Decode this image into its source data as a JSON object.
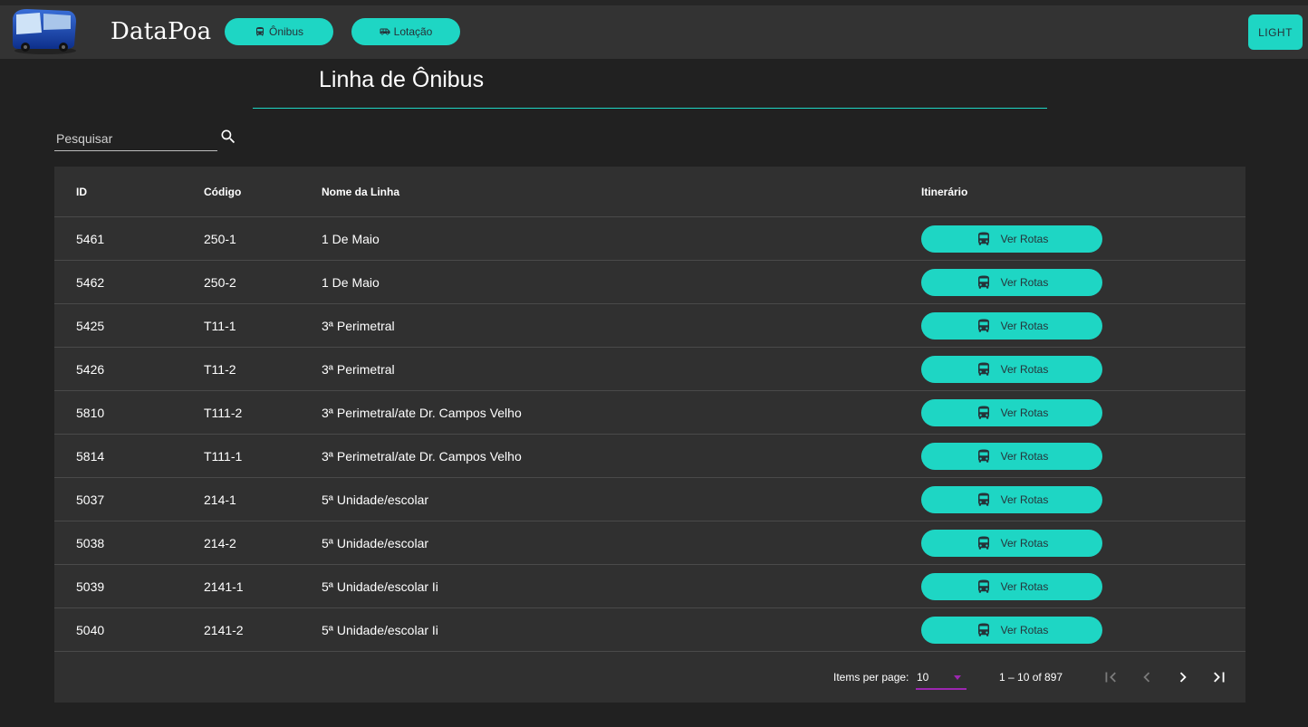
{
  "header": {
    "brand": "DataPoa",
    "nav": [
      {
        "label": "Ônibus",
        "icon": "bus-icon"
      },
      {
        "label": "Lotação",
        "icon": "shuttle-van-icon"
      }
    ],
    "theme_toggle": "LIGHT",
    "logo_icon": "bus-logo-icon"
  },
  "page": {
    "title": "Linha de Ônibus"
  },
  "search": {
    "placeholder": "Pesquisar",
    "value": "",
    "icon": "search-icon"
  },
  "table": {
    "columns": [
      "ID",
      "Código",
      "Nome da Linha",
      "Itinerário"
    ],
    "rows": [
      {
        "id": "5461",
        "codigo": "250-1",
        "nome": "1 De Maio",
        "action": "Ver Rotas"
      },
      {
        "id": "5462",
        "codigo": "250-2",
        "nome": "1 De Maio",
        "action": "Ver Rotas"
      },
      {
        "id": "5425",
        "codigo": "T11-1",
        "nome": "3ª Perimetral",
        "action": "Ver Rotas"
      },
      {
        "id": "5426",
        "codigo": "T11-2",
        "nome": "3ª Perimetral",
        "action": "Ver Rotas"
      },
      {
        "id": "5810",
        "codigo": "T111-2",
        "nome": "3ª Perimetral/ate Dr. Campos Velho",
        "action": "Ver Rotas"
      },
      {
        "id": "5814",
        "codigo": "T111-1",
        "nome": "3ª Perimetral/ate Dr. Campos Velho",
        "action": "Ver Rotas"
      },
      {
        "id": "5037",
        "codigo": "214-1",
        "nome": "5ª Unidade/escolar",
        "action": "Ver Rotas"
      },
      {
        "id": "5038",
        "codigo": "214-2",
        "nome": "5ª Unidade/escolar",
        "action": "Ver Rotas"
      },
      {
        "id": "5039",
        "codigo": "2141-1",
        "nome": "5ª Unidade/escolar Ii",
        "action": "Ver Rotas"
      },
      {
        "id": "5040",
        "codigo": "2141-2",
        "nome": "5ª Unidade/escolar Ii",
        "action": "Ver Rotas"
      }
    ]
  },
  "paginator": {
    "items_per_page_label": "Items per page:",
    "items_per_page_value": "10",
    "range_label": "1 – 10 of 897"
  },
  "colors": {
    "accent": "#1ed6c4",
    "background": "#212121",
    "toolbar": "#333333",
    "card": "#303030",
    "select_underline": "#9c27b0"
  }
}
